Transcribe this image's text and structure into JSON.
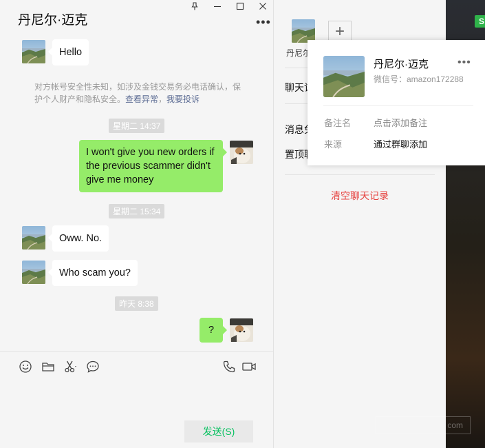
{
  "chat": {
    "title": "丹尼尔·迈克",
    "more_label": "•••",
    "window_buttons": {
      "pin": "📌",
      "minimize": "—",
      "maximize": "☐",
      "close": "✕"
    },
    "messages": [
      {
        "text": "Hello"
      },
      {
        "text": "I won't give you new orders if the previous scammer didn't give me money"
      },
      {
        "text": "Oww. No."
      },
      {
        "text": "Who scam you?"
      },
      {
        "text": "?"
      }
    ],
    "times": [
      "星期二 14:37",
      "星期二 15:34",
      "昨天 8:38"
    ],
    "notice": {
      "text": "对方帐号安全性未知，如涉及金钱交易务必电话确认，保护个人财产和隐私安全。",
      "link_check": "查看异常",
      "separator": "，",
      "link_report": "我要投诉"
    },
    "send_label": "发送(S)"
  },
  "info": {
    "member_name": "丹尼尔",
    "add_label": "+",
    "labels": {
      "chat_info": "聊天记",
      "mute": "消息免",
      "pin_top": "置顶聊"
    },
    "clear_history": "清空聊天记录"
  },
  "card": {
    "name": "丹尼尔·迈克",
    "wechat_id": "微信号：amazon172288",
    "more_label": "•••",
    "remark_label": "备注名",
    "remark_value": "点击添加备注",
    "source_label": "来源",
    "source_value": "通过群聊添加"
  },
  "desktop": {
    "badge": "S",
    "watermark": "com"
  },
  "colors": {
    "bubble_out": "#95ec69",
    "bubble_in": "#ffffff",
    "send_text": "#07c160",
    "danger": "#e64340",
    "link": "#5b6b93"
  }
}
